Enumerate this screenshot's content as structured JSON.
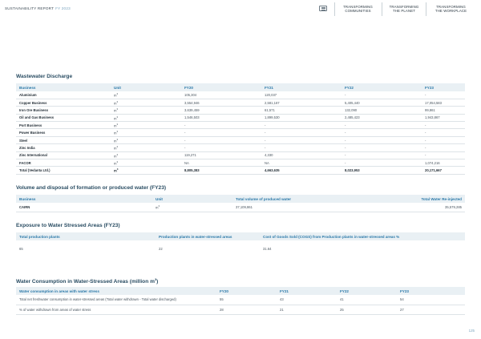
{
  "header": {
    "report_title": "SUSTAINABILITY REPORT",
    "report_year": "FY 2023",
    "menu_icon": "menu-icon",
    "nav_tabs": [
      {
        "line1": "TRANSFORMING",
        "line2": "COMMUNITIES"
      },
      {
        "line1": "TRANSFORMING",
        "line2": "THE PLANET"
      },
      {
        "line1": "TRANSFORMING",
        "line2": "THE WORKPLACE"
      }
    ]
  },
  "wastewater": {
    "title": "Wastewater Discharge",
    "headers": [
      "Business",
      "Unit",
      "FY20",
      "FY21",
      "FY22",
      "FY23"
    ],
    "rows": [
      {
        "business": "Aluminium",
        "unit": "m",
        "fy20": "105,304",
        "fy21": "120,037",
        "fy22": "-",
        "fy23": "-"
      },
      {
        "business": "Copper Business",
        "unit": "m",
        "fy20": "3,554,946",
        "fy21": "2,581,167",
        "fy22": "5,405,440",
        "fy23": "17,054,583"
      },
      {
        "business": "Iron Ore Business",
        "unit": "m",
        "fy20": "3,639,459",
        "fy21": "61,571",
        "fy22": "132,090",
        "fy23": "99,861"
      },
      {
        "business": "Oil and Gas Business",
        "unit": "m",
        "fy20": "1,546,503",
        "fy21": "1,899,530",
        "fy22": "2,485,423",
        "fy23": "1,943,867"
      },
      {
        "business": "Port Business",
        "unit": "m",
        "fy20": "-",
        "fy21": "-",
        "fy22": "-",
        "fy23": "-"
      },
      {
        "business": "Power Business",
        "unit": "m",
        "fy20": "-",
        "fy21": "-",
        "fy22": "-",
        "fy23": "-"
      },
      {
        "business": "Steel",
        "unit": "m",
        "fy20": "-",
        "fy21": "-",
        "fy22": "-",
        "fy23": "-"
      },
      {
        "business": "Zinc India",
        "unit": "m",
        "fy20": "-",
        "fy21": "-",
        "fy22": "-",
        "fy23": "-"
      },
      {
        "business": "Zinc International",
        "unit": "m",
        "fy20": "119,271",
        "fy21": "4,330",
        "fy22": "-",
        "fy23": "-"
      },
      {
        "business": "FACOR",
        "unit": "m",
        "fy20": "NA",
        "fy21": "NA",
        "fy22": "-",
        "fy23": "1,074,216"
      }
    ],
    "total": {
      "business": "Total (Vedanta Ltd.)",
      "unit": "m",
      "fy20": "8,805,383",
      "fy21": "4,663,635",
      "fy22": "8,023,953",
      "fy23": "20,171,667"
    }
  },
  "produced_water": {
    "title": "Volume and disposal of formation or produced water (FY23)",
    "headers": [
      "Business",
      "Unit",
      "Total volume of produced water",
      "Total Water Re-injected"
    ],
    "rows": [
      {
        "business": "CAIRN",
        "unit": "m",
        "total_volume": "37,109,861",
        "reinjected": "35,579,285"
      }
    ]
  },
  "stressed_areas": {
    "title": "Exposure to Water Stressed Areas (FY23)",
    "headers": [
      "Total production plants",
      "Production plants in water-stressed areas",
      "Cost of Goods Sold (COGS) from Production plants in water-stressed areas %"
    ],
    "rows": [
      {
        "total_plants": "65",
        "plants_stressed": "22",
        "cogs_pct": "31.64"
      }
    ]
  },
  "consumption": {
    "title": "Water Consumption in Water-Stressed Areas (million m",
    "title_sup": "3",
    "title_end": ")",
    "headers": [
      "Water consumption in areas with water stress",
      "FY20",
      "FY21",
      "FY22",
      "FY23"
    ],
    "rows": [
      {
        "label": "Total net freshwater consumption in water-stressed areas (Total water withdrawn - Total water discharged)",
        "fy20": "55",
        "fy21": "43",
        "fy22": "41",
        "fy23": "54"
      },
      {
        "label": "% of water withdrawn from areas of water stress",
        "fy20": "28",
        "fy21": "21",
        "fy22": "25",
        "fy23": "27"
      }
    ]
  },
  "page_number": "125"
}
